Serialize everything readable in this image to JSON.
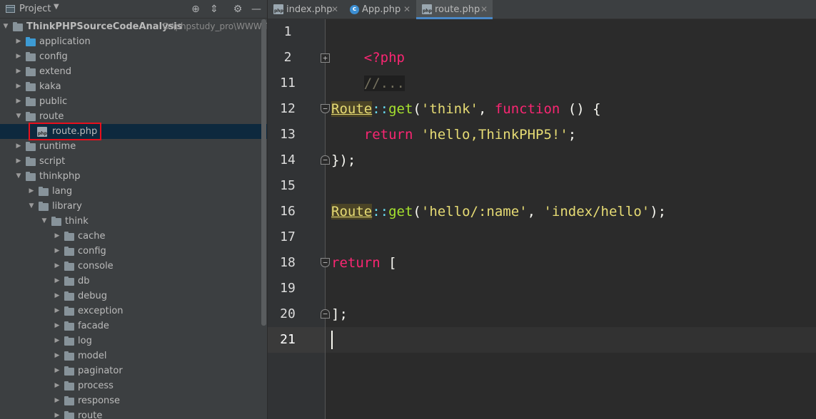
{
  "project_panel": {
    "title": "Project",
    "dropdown_icon": "caret-down-icon",
    "buttons": [
      "locate-icon",
      "collapse-all-icon",
      "gear-icon",
      "minimize-icon"
    ],
    "root": {
      "name": "ThinkPHPSourceCodeAnalysis",
      "path": "D:\\phpstudy_pro\\WWW\\T"
    },
    "tree": [
      {
        "label": "application",
        "type": "folder-blue",
        "state": "collapsed",
        "depth": 1
      },
      {
        "label": "config",
        "type": "folder",
        "state": "collapsed",
        "depth": 1
      },
      {
        "label": "extend",
        "type": "folder",
        "state": "collapsed",
        "depth": 1
      },
      {
        "label": "kaka",
        "type": "folder",
        "state": "collapsed",
        "depth": 1
      },
      {
        "label": "public",
        "type": "folder",
        "state": "collapsed",
        "depth": 1
      },
      {
        "label": "route",
        "type": "folder",
        "state": "expanded",
        "depth": 1
      },
      {
        "label": "route.php",
        "type": "php-file",
        "state": "leaf",
        "depth": 2,
        "selected": true
      },
      {
        "label": "runtime",
        "type": "folder",
        "state": "collapsed",
        "depth": 1
      },
      {
        "label": "script",
        "type": "folder",
        "state": "collapsed",
        "depth": 1
      },
      {
        "label": "thinkphp",
        "type": "folder",
        "state": "expanded",
        "depth": 1
      },
      {
        "label": "lang",
        "type": "folder",
        "state": "collapsed",
        "depth": 2
      },
      {
        "label": "library",
        "type": "folder",
        "state": "expanded",
        "depth": 2
      },
      {
        "label": "think",
        "type": "folder",
        "state": "expanded",
        "depth": 3
      },
      {
        "label": "cache",
        "type": "folder",
        "state": "collapsed",
        "depth": 4
      },
      {
        "label": "config",
        "type": "folder",
        "state": "collapsed",
        "depth": 4
      },
      {
        "label": "console",
        "type": "folder",
        "state": "collapsed",
        "depth": 4
      },
      {
        "label": "db",
        "type": "folder",
        "state": "collapsed",
        "depth": 4
      },
      {
        "label": "debug",
        "type": "folder",
        "state": "collapsed",
        "depth": 4
      },
      {
        "label": "exception",
        "type": "folder",
        "state": "collapsed",
        "depth": 4
      },
      {
        "label": "facade",
        "type": "folder",
        "state": "collapsed",
        "depth": 4
      },
      {
        "label": "log",
        "type": "folder",
        "state": "collapsed",
        "depth": 4
      },
      {
        "label": "model",
        "type": "folder",
        "state": "collapsed",
        "depth": 4
      },
      {
        "label": "paginator",
        "type": "folder",
        "state": "collapsed",
        "depth": 4
      },
      {
        "label": "process",
        "type": "folder",
        "state": "collapsed",
        "depth": 4
      },
      {
        "label": "response",
        "type": "folder",
        "state": "collapsed",
        "depth": 4
      },
      {
        "label": "route",
        "type": "folder",
        "state": "collapsed",
        "depth": 4
      }
    ]
  },
  "tabs": [
    {
      "label": "index.php",
      "icon": "php-file-icon",
      "active": false
    },
    {
      "label": "App.php",
      "icon": "class-c-icon",
      "active": false
    },
    {
      "label": "route.php",
      "icon": "php-file-icon",
      "active": true
    }
  ],
  "editor": {
    "line_numbers": [
      "1",
      "2",
      "11",
      "12",
      "13",
      "14",
      "15",
      "16",
      "17",
      "18",
      "19",
      "20",
      "21"
    ],
    "current_line": "21",
    "code": {
      "l1": {
        "open_tag": "<?php"
      },
      "l2": {
        "folded": "//..."
      },
      "l12": {
        "cls": "Route",
        "op": "::",
        "fn": "get",
        "p1": "(",
        "s1": "'think'",
        "p2": ", ",
        "kw": "function",
        "p3": " () {"
      },
      "l13": {
        "indent": "    ",
        "kw": "return",
        "sp": " ",
        "s1": "'hello,ThinkPHP5!'",
        "p1": ";"
      },
      "l14": {
        "p1": "});"
      },
      "l16": {
        "cls": "Route",
        "op": "::",
        "fn": "get",
        "p1": "(",
        "s1": "'hello/:name'",
        "p2": ", ",
        "s2": "'index/hello'",
        "p3": ");"
      },
      "l18": {
        "kw": "return",
        "p1": " ["
      },
      "l20": {
        "p1": "];"
      }
    },
    "colors": {
      "keyword": "#f92672",
      "string": "#e6db74",
      "function": "#a6e22e",
      "operator": "#66d9ef",
      "background": "#2b2b2b"
    }
  }
}
